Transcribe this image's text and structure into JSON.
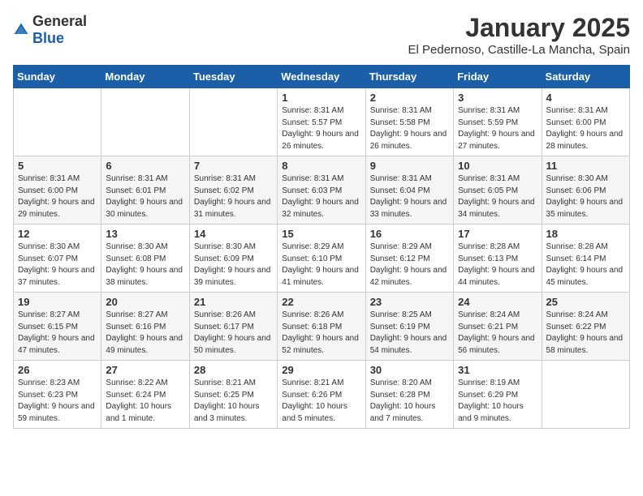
{
  "header": {
    "logo_general": "General",
    "logo_blue": "Blue",
    "month": "January 2025",
    "location": "El Pedernoso, Castille-La Mancha, Spain"
  },
  "weekdays": [
    "Sunday",
    "Monday",
    "Tuesday",
    "Wednesday",
    "Thursday",
    "Friday",
    "Saturday"
  ],
  "weeks": [
    [
      {
        "day": "",
        "info": ""
      },
      {
        "day": "",
        "info": ""
      },
      {
        "day": "",
        "info": ""
      },
      {
        "day": "1",
        "info": "Sunrise: 8:31 AM\nSunset: 5:57 PM\nDaylight: 9 hours and 26 minutes."
      },
      {
        "day": "2",
        "info": "Sunrise: 8:31 AM\nSunset: 5:58 PM\nDaylight: 9 hours and 26 minutes."
      },
      {
        "day": "3",
        "info": "Sunrise: 8:31 AM\nSunset: 5:59 PM\nDaylight: 9 hours and 27 minutes."
      },
      {
        "day": "4",
        "info": "Sunrise: 8:31 AM\nSunset: 6:00 PM\nDaylight: 9 hours and 28 minutes."
      }
    ],
    [
      {
        "day": "5",
        "info": "Sunrise: 8:31 AM\nSunset: 6:00 PM\nDaylight: 9 hours and 29 minutes."
      },
      {
        "day": "6",
        "info": "Sunrise: 8:31 AM\nSunset: 6:01 PM\nDaylight: 9 hours and 30 minutes."
      },
      {
        "day": "7",
        "info": "Sunrise: 8:31 AM\nSunset: 6:02 PM\nDaylight: 9 hours and 31 minutes."
      },
      {
        "day": "8",
        "info": "Sunrise: 8:31 AM\nSunset: 6:03 PM\nDaylight: 9 hours and 32 minutes."
      },
      {
        "day": "9",
        "info": "Sunrise: 8:31 AM\nSunset: 6:04 PM\nDaylight: 9 hours and 33 minutes."
      },
      {
        "day": "10",
        "info": "Sunrise: 8:31 AM\nSunset: 6:05 PM\nDaylight: 9 hours and 34 minutes."
      },
      {
        "day": "11",
        "info": "Sunrise: 8:30 AM\nSunset: 6:06 PM\nDaylight: 9 hours and 35 minutes."
      }
    ],
    [
      {
        "day": "12",
        "info": "Sunrise: 8:30 AM\nSunset: 6:07 PM\nDaylight: 9 hours and 37 minutes."
      },
      {
        "day": "13",
        "info": "Sunrise: 8:30 AM\nSunset: 6:08 PM\nDaylight: 9 hours and 38 minutes."
      },
      {
        "day": "14",
        "info": "Sunrise: 8:30 AM\nSunset: 6:09 PM\nDaylight: 9 hours and 39 minutes."
      },
      {
        "day": "15",
        "info": "Sunrise: 8:29 AM\nSunset: 6:10 PM\nDaylight: 9 hours and 41 minutes."
      },
      {
        "day": "16",
        "info": "Sunrise: 8:29 AM\nSunset: 6:12 PM\nDaylight: 9 hours and 42 minutes."
      },
      {
        "day": "17",
        "info": "Sunrise: 8:28 AM\nSunset: 6:13 PM\nDaylight: 9 hours and 44 minutes."
      },
      {
        "day": "18",
        "info": "Sunrise: 8:28 AM\nSunset: 6:14 PM\nDaylight: 9 hours and 45 minutes."
      }
    ],
    [
      {
        "day": "19",
        "info": "Sunrise: 8:27 AM\nSunset: 6:15 PM\nDaylight: 9 hours and 47 minutes."
      },
      {
        "day": "20",
        "info": "Sunrise: 8:27 AM\nSunset: 6:16 PM\nDaylight: 9 hours and 49 minutes."
      },
      {
        "day": "21",
        "info": "Sunrise: 8:26 AM\nSunset: 6:17 PM\nDaylight: 9 hours and 50 minutes."
      },
      {
        "day": "22",
        "info": "Sunrise: 8:26 AM\nSunset: 6:18 PM\nDaylight: 9 hours and 52 minutes."
      },
      {
        "day": "23",
        "info": "Sunrise: 8:25 AM\nSunset: 6:19 PM\nDaylight: 9 hours and 54 minutes."
      },
      {
        "day": "24",
        "info": "Sunrise: 8:24 AM\nSunset: 6:21 PM\nDaylight: 9 hours and 56 minutes."
      },
      {
        "day": "25",
        "info": "Sunrise: 8:24 AM\nSunset: 6:22 PM\nDaylight: 9 hours and 58 minutes."
      }
    ],
    [
      {
        "day": "26",
        "info": "Sunrise: 8:23 AM\nSunset: 6:23 PM\nDaylight: 9 hours and 59 minutes."
      },
      {
        "day": "27",
        "info": "Sunrise: 8:22 AM\nSunset: 6:24 PM\nDaylight: 10 hours and 1 minute."
      },
      {
        "day": "28",
        "info": "Sunrise: 8:21 AM\nSunset: 6:25 PM\nDaylight: 10 hours and 3 minutes."
      },
      {
        "day": "29",
        "info": "Sunrise: 8:21 AM\nSunset: 6:26 PM\nDaylight: 10 hours and 5 minutes."
      },
      {
        "day": "30",
        "info": "Sunrise: 8:20 AM\nSunset: 6:28 PM\nDaylight: 10 hours and 7 minutes."
      },
      {
        "day": "31",
        "info": "Sunrise: 8:19 AM\nSunset: 6:29 PM\nDaylight: 10 hours and 9 minutes."
      },
      {
        "day": "",
        "info": ""
      }
    ]
  ]
}
